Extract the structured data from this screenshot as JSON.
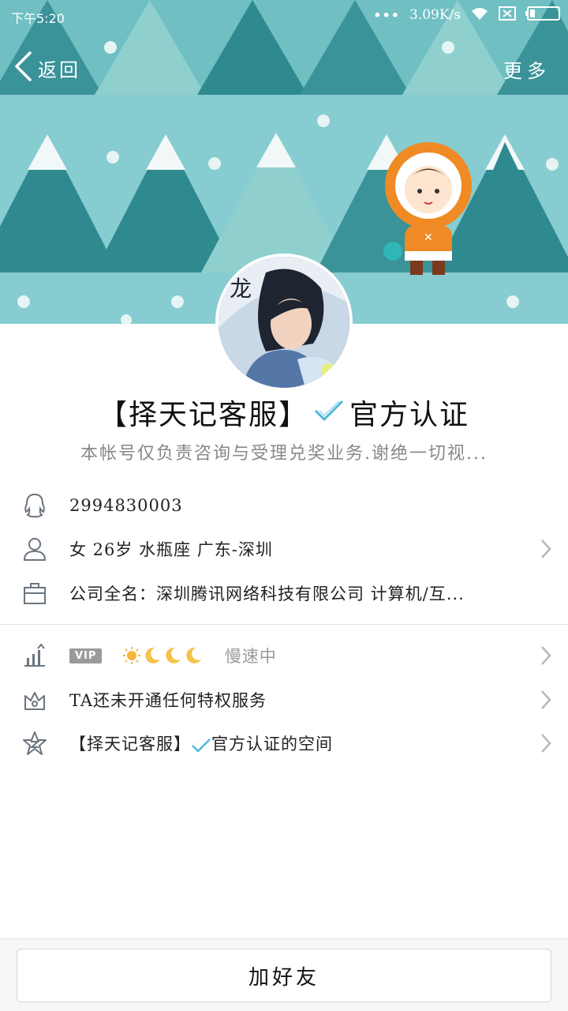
{
  "status_bar": {
    "time": "下午5:20",
    "dots": "•••",
    "net_speed": "3.09K/s"
  },
  "nav": {
    "back_label": "返回",
    "more_label": "更多"
  },
  "profile": {
    "name": "【择天记客服】",
    "certification": "官方认证",
    "bio": "本帐号仅负责咨询与受理兑奖业务.谢绝一切视..."
  },
  "info_rows": [
    {
      "icon": "qq-icon",
      "text": "2994830003"
    },
    {
      "icon": "person-icon",
      "text": "女  26岁  水瓶座  广东-深圳"
    },
    {
      "icon": "company-icon",
      "text": "公司全名：深圳腾讯网络科技有限公司 计算机/互..."
    }
  ],
  "vip_row": {
    "badge": "VIP",
    "speed_text": "慢速中"
  },
  "privilege_row": {
    "text": "TA还未开通任何特权服务"
  },
  "space_row": {
    "name": "【择天记客服】",
    "suffix": "官方认证的空间"
  },
  "bottom": {
    "add_friend_label": "加好友"
  },
  "colors": {
    "banner_bg": "#86ccd0",
    "tree_dark": "#2f8a90",
    "tree_mid": "#4fa5ab",
    "tree_light": "#8fd0cf",
    "check_blue": "#4fb8d8"
  }
}
